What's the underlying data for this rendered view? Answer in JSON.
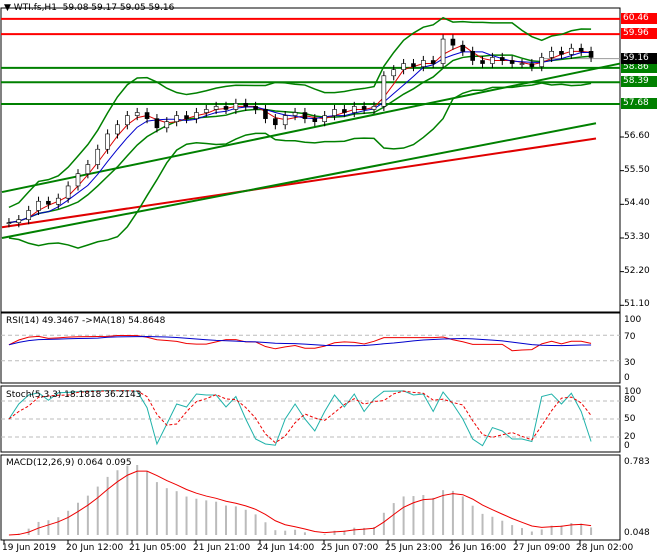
{
  "header": {
    "symbol": "WTI.fs,H1",
    "ohlc": "59.08 59.17 59.05 59.16"
  },
  "levels": [
    {
      "price": 60.46,
      "label": "60.46",
      "color": "#ff0000"
    },
    {
      "price": 59.96,
      "label": "59.96",
      "color": "#ff0000"
    },
    {
      "price": 58.86,
      "label": "58.86",
      "color": "#008000"
    },
    {
      "price": 58.39,
      "label": "58.39",
      "color": "#008000"
    },
    {
      "price": 57.68,
      "label": "57.68",
      "color": "#008000"
    }
  ],
  "current_price": {
    "label": "59.16",
    "price": 59.16,
    "color": "#000000"
  },
  "price_axis": [
    "56.60",
    "55.50",
    "54.40",
    "53.30",
    "52.20",
    "51.10"
  ],
  "price_axis_values": [
    56.6,
    55.5,
    54.4,
    53.3,
    52.2,
    51.1
  ],
  "closes": [
    53.8,
    53.9,
    54.2,
    54.5,
    54.4,
    54.6,
    55.0,
    55.4,
    55.7,
    56.2,
    56.7,
    57.0,
    57.3,
    57.4,
    57.2,
    56.9,
    57.1,
    57.3,
    57.2,
    57.4,
    57.5,
    57.6,
    57.5,
    57.7,
    57.6,
    57.5,
    57.2,
    57.0,
    57.3,
    57.4,
    57.2,
    57.1,
    57.3,
    57.5,
    57.4,
    57.6,
    57.5,
    57.6,
    58.6,
    58.8,
    59.0,
    58.9,
    59.1,
    59.0,
    59.8,
    59.6,
    59.4,
    59.1,
    59.0,
    59.2,
    59.1,
    59.0,
    59.0,
    58.9,
    59.2,
    59.4,
    59.3,
    59.5,
    59.4,
    59.2
  ],
  "rsi": {
    "title": "RSI(14) 49.3467  ->MA(18) 54.8648",
    "axis": [
      "100",
      "70",
      "30",
      "0"
    ]
  },
  "stoch": {
    "title": "Stoch(5,3,3) 18.1818 36.2143",
    "axis": [
      "100",
      "80",
      "50",
      "20",
      "0"
    ]
  },
  "macd": {
    "title": "MACD(12,26,9) 0.064 0.095",
    "axis": [
      "0.783",
      "0.048"
    ]
  },
  "time_axis": [
    "19 Jun 2019",
    "20 Jun 12:00",
    "21 Jun 05:00",
    "21 Jun 21:00",
    "24 Jun 14:00",
    "25 Jun 07:00",
    "25 Jun 23:00",
    "26 Jun 16:00",
    "27 Jun 09:00",
    "28 Jun 02:00"
  ]
}
